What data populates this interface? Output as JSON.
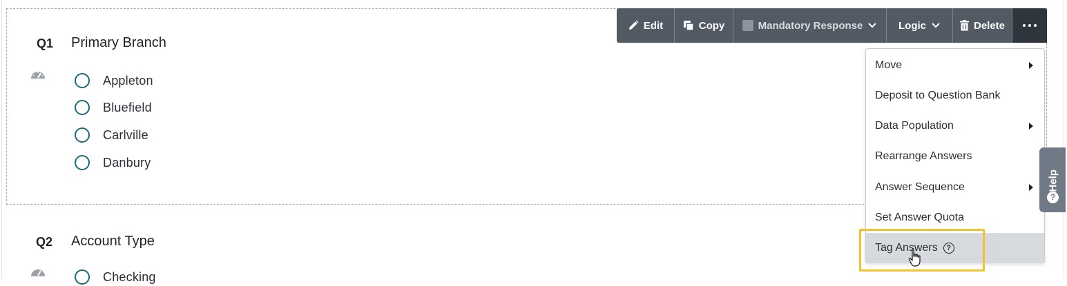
{
  "questions": [
    {
      "number": "Q1",
      "title": "Primary Branch",
      "answers": [
        "Appleton",
        "Bluefield",
        "Carlville",
        "Danbury"
      ]
    },
    {
      "number": "Q2",
      "title": "Account Type",
      "answers": [
        "Checking"
      ]
    }
  ],
  "toolbar": {
    "edit_label": "Edit",
    "copy_label": "Copy",
    "mandatory_label": "Mandatory Response",
    "logic_label": "Logic",
    "delete_label": "Delete"
  },
  "menu": {
    "items": [
      {
        "label": "Move",
        "has_submenu": true
      },
      {
        "label": "Deposit to Question Bank",
        "has_submenu": false
      },
      {
        "label": "Data Population",
        "has_submenu": true
      },
      {
        "label": "Rearrange Answers",
        "has_submenu": false
      },
      {
        "label": "Answer Sequence",
        "has_submenu": true
      },
      {
        "label": "Set Answer Quota",
        "has_submenu": false
      },
      {
        "label": "Tag Answers",
        "has_submenu": false,
        "active": true
      }
    ]
  },
  "help_tab": {
    "label": "Help",
    "icon": "question-icon"
  },
  "colors": {
    "toolbar_bg": "#525a64",
    "more_button_bg": "#2f353c",
    "radio_border": "#1a6b73",
    "highlight": "#f2c12e",
    "menu_active_bg": "#d6dade",
    "help_tab_bg": "#6f7a86"
  }
}
